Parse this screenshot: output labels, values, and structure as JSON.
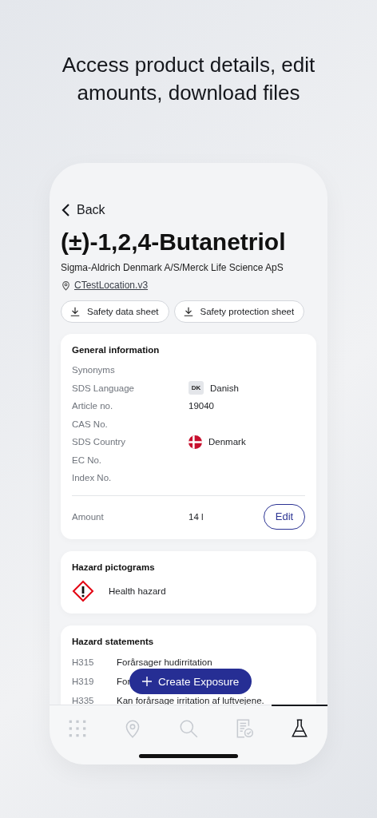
{
  "headline": "Access product details, edit amounts, download files",
  "back": {
    "label": "Back"
  },
  "product": {
    "name": "(±)-1,2,4-Butanetriol",
    "supplier": "Sigma-Aldrich Denmark A/S/Merck Life Science ApS",
    "location": "CTestLocation.v3"
  },
  "downloads": [
    "Safety data sheet",
    "Safety protection sheet"
  ],
  "general": {
    "title": "General information",
    "rows": [
      {
        "label": "Synonyms"
      },
      {
        "label": "SDS Language",
        "value": "Danish",
        "kind": "language",
        "badge": "DK"
      },
      {
        "label": "Article no.",
        "value": "19040"
      },
      {
        "label": "CAS No."
      },
      {
        "label": "SDS Country",
        "value": "Denmark",
        "kind": "flag"
      },
      {
        "label": "EC No."
      },
      {
        "label": "Index No."
      }
    ],
    "amount": {
      "label": "Amount",
      "value": "14 l",
      "button": "Edit"
    }
  },
  "pictograms": {
    "title": "Hazard pictograms",
    "items": [
      "Health hazard"
    ]
  },
  "statements": {
    "title": "Hazard statements",
    "items": [
      {
        "code": "H315",
        "text": "Forårsager hudirritation"
      },
      {
        "code": "H319",
        "text": "For"
      },
      {
        "code": "H335",
        "text": "Kan forårsage irritation af luftvejene."
      }
    ]
  },
  "fab": {
    "label": "Create Exposure"
  },
  "nav": [
    {
      "kind": "grid",
      "selected": false
    },
    {
      "kind": "pin",
      "selected": false
    },
    {
      "kind": "search",
      "selected": false
    },
    {
      "kind": "report",
      "selected": false
    },
    {
      "kind": "flask",
      "selected": true
    }
  ]
}
